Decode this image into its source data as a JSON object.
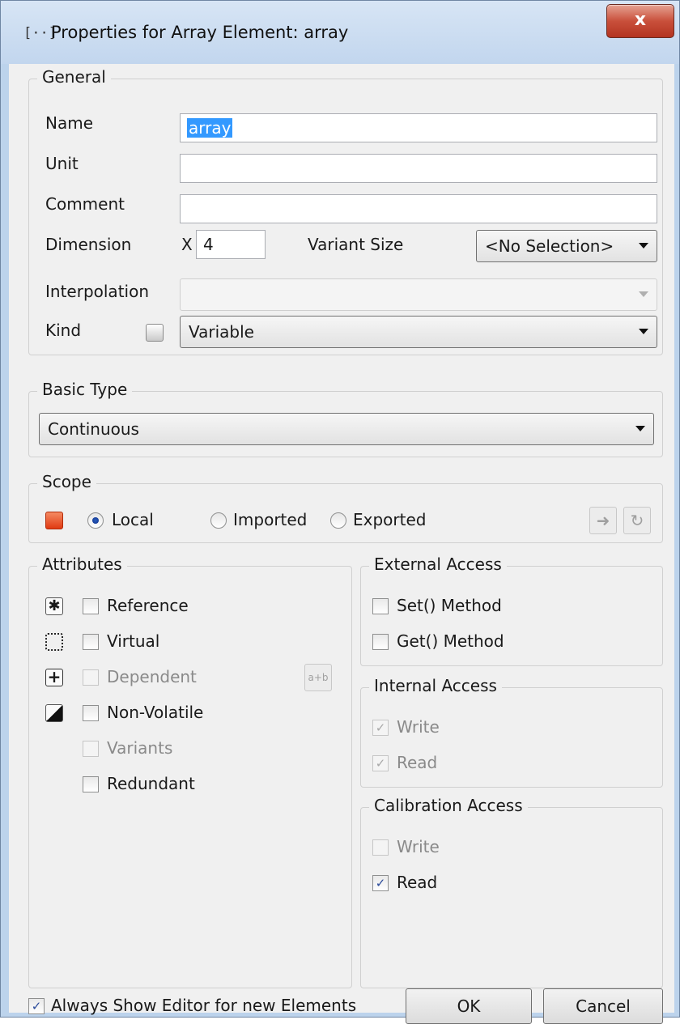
{
  "window": {
    "title": "Properties for Array Element: array",
    "close_label": "x"
  },
  "general": {
    "legend": "General",
    "name_label": "Name",
    "name_value": "array",
    "unit_label": "Unit",
    "unit_value": "",
    "comment_label": "Comment",
    "comment_value": "",
    "dimension_label": "Dimension",
    "dimension_axis": "X",
    "dimension_value": "4",
    "variant_size_label": "Variant Size",
    "variant_size_value": "<No Selection>",
    "interpolation_label": "Interpolation",
    "interpolation_value": "",
    "kind_label": "Kind",
    "kind_value": "Variable"
  },
  "basic_type": {
    "legend": "Basic Type",
    "value": "Continuous"
  },
  "scope": {
    "legend": "Scope",
    "local": "Local",
    "imported": "Imported",
    "exported": "Exported",
    "selected": "Local",
    "accent": "#e8481c"
  },
  "attributes": {
    "legend": "Attributes",
    "items": [
      {
        "label": "Reference",
        "checked": false,
        "enabled": true
      },
      {
        "label": "Virtual",
        "checked": false,
        "enabled": true
      },
      {
        "label": "Dependent",
        "checked": false,
        "enabled": false
      },
      {
        "label": "Non-Volatile",
        "checked": false,
        "enabled": true
      },
      {
        "label": "Variants",
        "checked": false,
        "enabled": false
      },
      {
        "label": "Redundant",
        "checked": false,
        "enabled": true
      }
    ]
  },
  "external_access": {
    "legend": "External Access",
    "set_method": "Set() Method",
    "get_method": "Get() Method"
  },
  "internal_access": {
    "legend": "Internal Access",
    "write": "Write",
    "read": "Read"
  },
  "calibration_access": {
    "legend": "Calibration Access",
    "write": "Write",
    "read": "Read"
  },
  "footer": {
    "always_show": "Always Show Editor for new Elements",
    "ok": "OK",
    "cancel": "Cancel"
  }
}
